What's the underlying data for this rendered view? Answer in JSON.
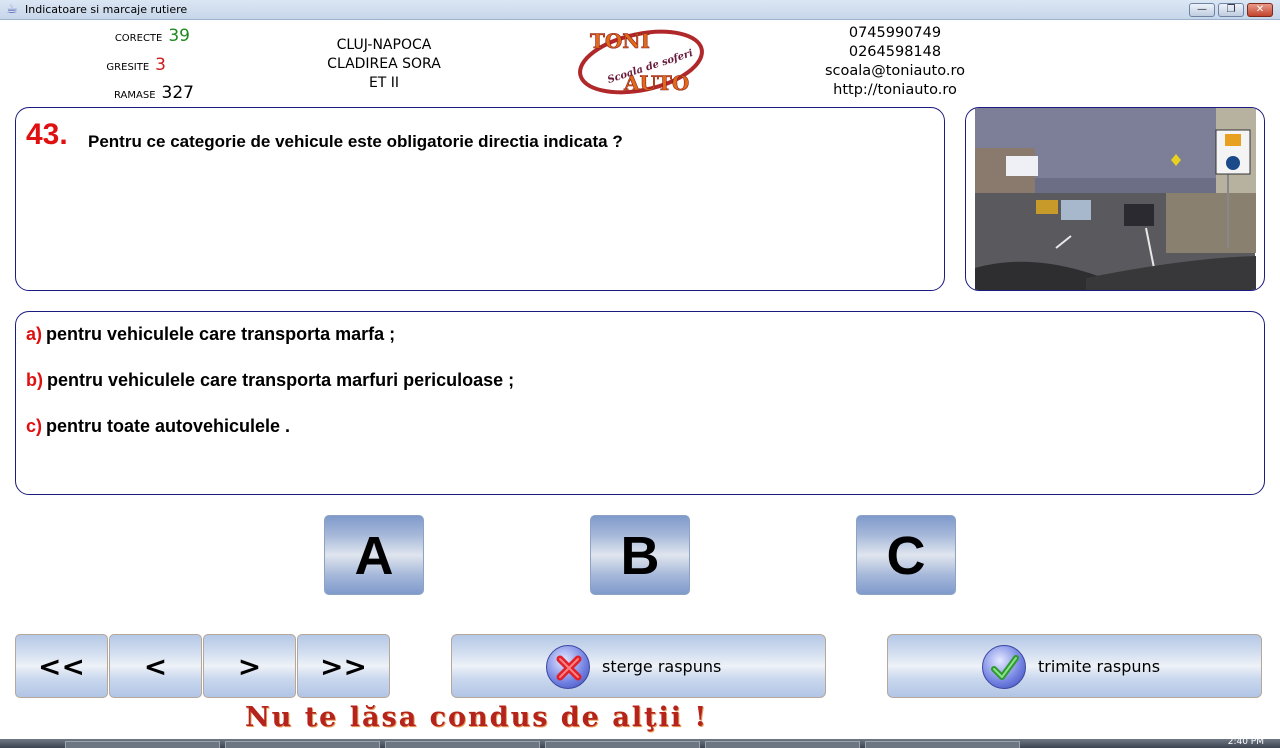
{
  "window": {
    "title": "Indicatoare si marcaje rutiere",
    "controls": {
      "minimize": "—",
      "restore": "❐",
      "close": "✕"
    }
  },
  "stats": {
    "correct": {
      "label": "CORECTE",
      "value": "39",
      "color": "#1f8a1f"
    },
    "wrong": {
      "label": "GRESITE",
      "value": "3",
      "color": "#d01818"
    },
    "remaining": {
      "label": "RAMASE",
      "value": "327",
      "color": "#000000"
    }
  },
  "address": {
    "line1": "CLUJ-NAPOCA",
    "line2": "CLADIREA SORA",
    "line3": "ET II"
  },
  "logo": {
    "top": "TONI",
    "middle": "Scoala de soferi",
    "bottom": "AUTO"
  },
  "contact": {
    "phone1": "0745990749",
    "phone2": "0264598148",
    "email": "scoala@toniauto.ro",
    "website": "http://toniauto.ro"
  },
  "question": {
    "number": "43.",
    "text": "Pentru ce categorie de vehicule este obligatorie directia indicata ?"
  },
  "answers": [
    {
      "letter": "a)",
      "text": "pentru vehiculele care transporta marfa ;"
    },
    {
      "letter": "b)",
      "text": "pentru vehiculele care transporta marfuri periculoase ;"
    },
    {
      "letter": "c)",
      "text": "pentru toate autovehiculele ."
    }
  ],
  "choice_buttons": [
    "A",
    "B",
    "C"
  ],
  "navigation": {
    "first": "<<",
    "prev": "<",
    "next": ">",
    "last": ">>"
  },
  "actions": {
    "clear": {
      "label": "sterge raspuns",
      "icon": "x-icon"
    },
    "submit": {
      "label": "trimite raspuns",
      "icon": "checkmark-icon"
    }
  },
  "slogan": "Nu te lăsa condus de alţii !",
  "taskbar": {
    "clock": "2:40 PM"
  }
}
